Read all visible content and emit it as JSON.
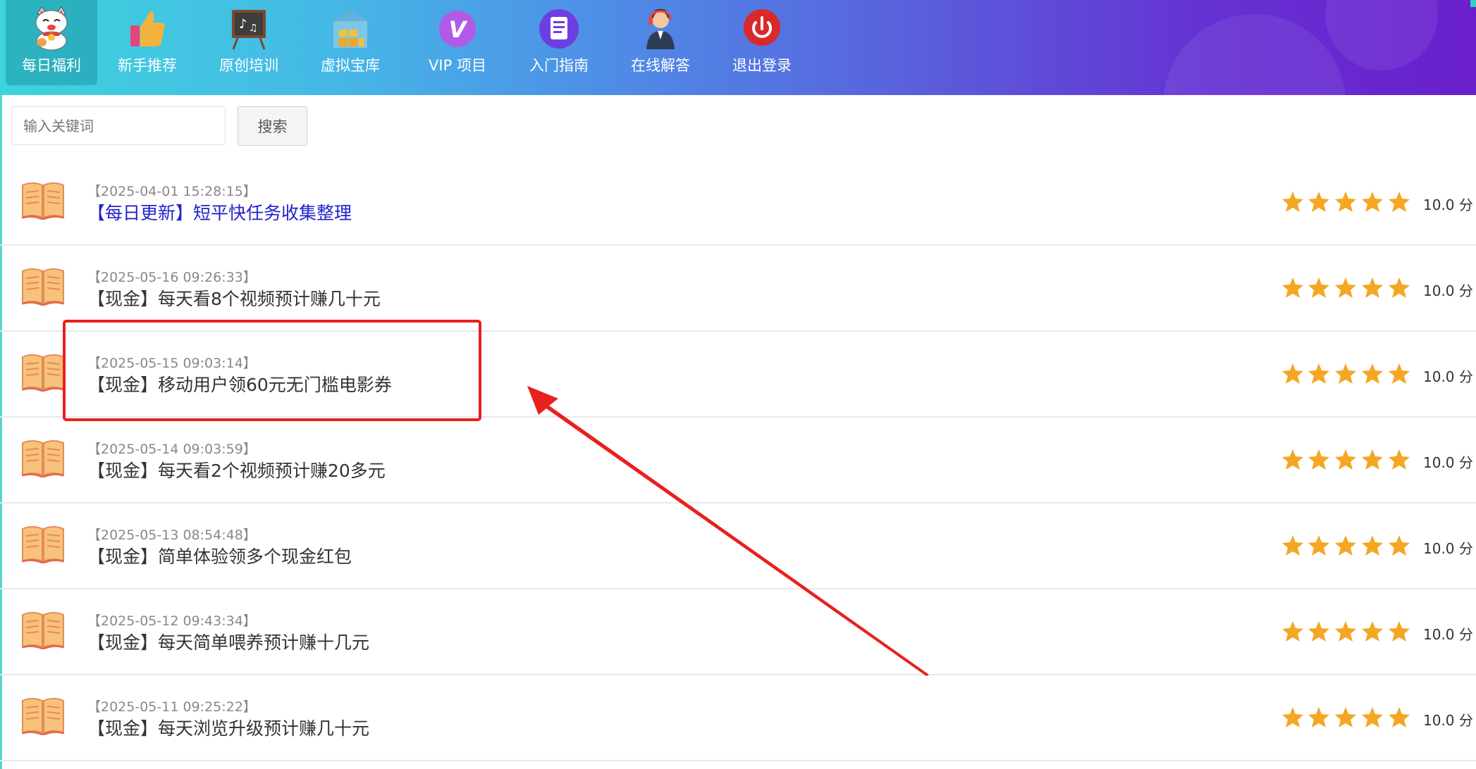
{
  "nav": {
    "items": [
      {
        "label": "每日福利",
        "icon": "lucky-cat-icon",
        "active": true
      },
      {
        "label": "新手推荐",
        "icon": "thumbs-up-icon",
        "active": false
      },
      {
        "label": "原创培训",
        "icon": "chalkboard-icon",
        "active": false
      },
      {
        "label": "虚拟宝库",
        "icon": "warehouse-icon",
        "active": false
      },
      {
        "label": "VIP 项目",
        "icon": "vip-v-icon",
        "active": false
      },
      {
        "label": "入门指南",
        "icon": "document-icon",
        "active": false
      },
      {
        "label": "在线解答",
        "icon": "support-agent-icon",
        "active": false
      },
      {
        "label": "退出登录",
        "icon": "power-icon",
        "active": false
      }
    ]
  },
  "search": {
    "placeholder": "输入关键词",
    "button_label": "搜索"
  },
  "colors": {
    "header_gradient_start": "#3ed3dc",
    "header_gradient_end": "#6a1fcd",
    "star": "#f5a623",
    "highlight_title": "#2222cc",
    "annotation_red": "#e8201e"
  },
  "list": {
    "items": [
      {
        "timestamp": "【2025-04-01 15:28:15】",
        "title": "【每日更新】短平快任务收集整理",
        "rating": 5,
        "score": "10.0 分",
        "highlight": true
      },
      {
        "timestamp": "【2025-05-16 09:26:33】",
        "title": "【现金】每天看8个视频预计赚几十元",
        "rating": 5,
        "score": "10.0 分",
        "highlight": false
      },
      {
        "timestamp": "【2025-05-15 09:03:14】",
        "title": "【现金】移动用户领60元无门槛电影券",
        "rating": 5,
        "score": "10.0 分",
        "highlight": false
      },
      {
        "timestamp": "【2025-05-14 09:03:59】",
        "title": "【现金】每天看2个视频预计赚20多元",
        "rating": 5,
        "score": "10.0 分",
        "highlight": false
      },
      {
        "timestamp": "【2025-05-13 08:54:48】",
        "title": "【现金】简单体验领多个现金红包",
        "rating": 5,
        "score": "10.0 分",
        "highlight": false
      },
      {
        "timestamp": "【2025-05-12 09:43:34】",
        "title": "【现金】每天简单喂养预计赚十几元",
        "rating": 5,
        "score": "10.0 分",
        "highlight": false
      },
      {
        "timestamp": "【2025-05-11 09:25:22】",
        "title": "【现金】每天浏览升级预计赚几十元",
        "rating": 5,
        "score": "10.0 分",
        "highlight": false
      }
    ]
  }
}
